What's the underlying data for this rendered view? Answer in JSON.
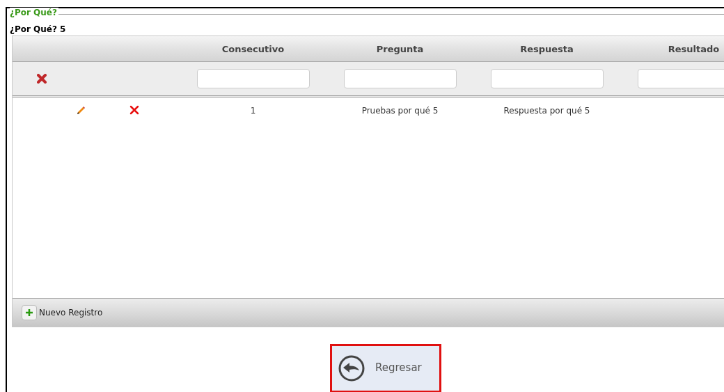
{
  "legend": "¿Por Qué?",
  "grid_title": "¿Por Qué? 5",
  "columns": [
    "Consecutivo",
    "Pregunta",
    "Respuesta",
    "Resultado"
  ],
  "rows": [
    {
      "consecutivo": "1",
      "pregunta": "Pruebas por qué 5",
      "respuesta": "Respuesta por qué 5"
    }
  ],
  "footer": {
    "add_button": "Nuevo Registro"
  },
  "back_button": {
    "label": "Regresar",
    "highlighted": true
  }
}
